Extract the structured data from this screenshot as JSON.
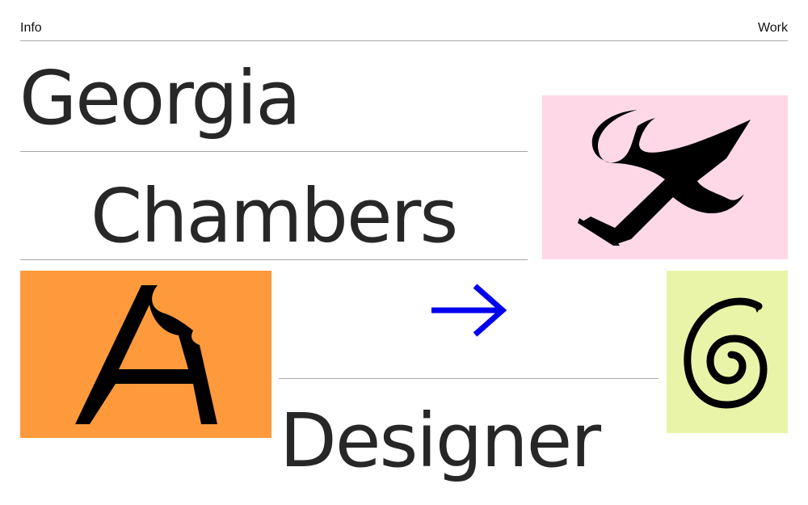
{
  "nav": {
    "info_label": "Info",
    "work_label": "Work"
  },
  "hero": {
    "first_name": "Georgia",
    "last_name": "Chambers",
    "role": "Designer"
  },
  "tiles": [
    {
      "name": "tile-pink-glyph",
      "icon": "calligraphic-r-glyph-icon",
      "bg": "#ffd8e8"
    },
    {
      "name": "tile-orange-glyph",
      "icon": "bitten-a-glyph-icon",
      "bg": "#ff9a3c"
    },
    {
      "name": "tile-lime-glyph",
      "icon": "spiral-six-glyph-icon",
      "bg": "#eaf4a8"
    }
  ],
  "colors": {
    "accent": "#0000ee",
    "text": "#222222",
    "rule": "#a8a8a8"
  },
  "arrow": {
    "icon": "arrow-right-icon"
  }
}
